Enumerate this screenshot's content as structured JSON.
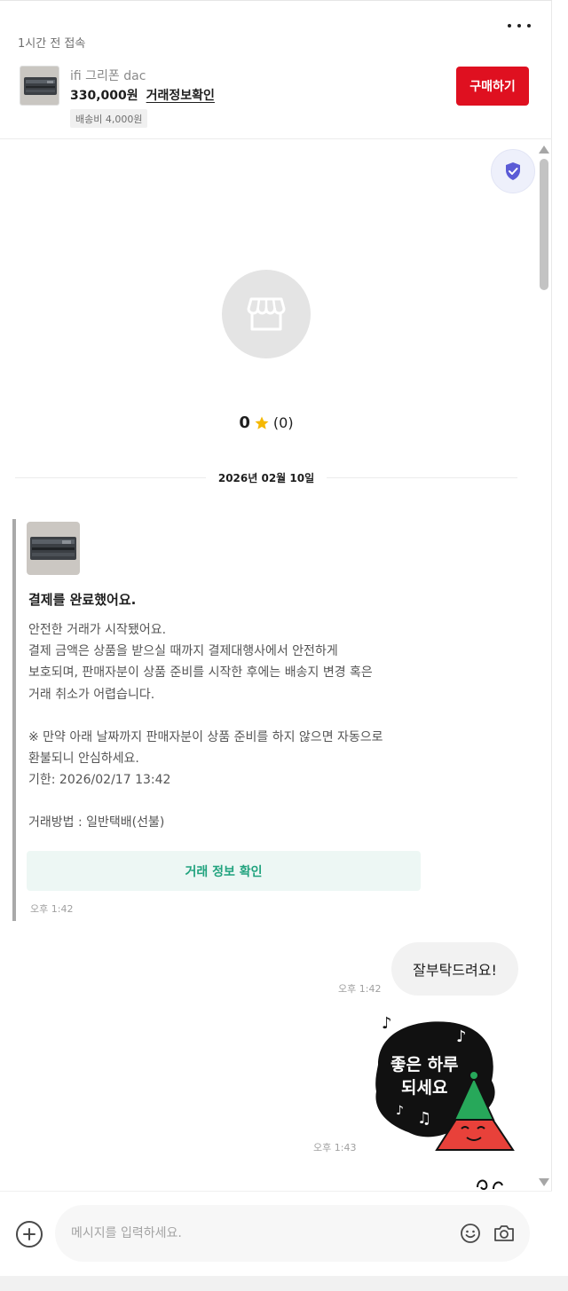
{
  "header": {
    "last_seen": "1시간 전 접속",
    "product_name": "ifi 그리폰 dac",
    "price": "330,000원",
    "deal_info_link": "거래정보확인",
    "shipping_fee": "배송비 4,000원",
    "buy_button": "구매하기",
    "more_icon": "more-horizontal-icon"
  },
  "profile": {
    "shield_icon": "shield-check-icon",
    "store_icon": "store-icon",
    "rating_score": "0",
    "rating_count": "(0)",
    "star_icon": "star-icon"
  },
  "date_divider": "2026년 02월 10일",
  "system_message": {
    "title": "결제를 완료했어요.",
    "body": [
      "안전한 거래가 시작됐어요.",
      "결제 금액은 상품을 받으실 때까지 결제대행사에서 안전하게",
      "보호되며, 판매자분이 상품 준비를 시작한 후에는 배송지 변경 혹은",
      "거래 취소가 어렵습니다.",
      "",
      "※ 만약 아래 날짜까지 판매자분이 상품 준비를 하지 않으면 자동으로",
      "환불되니 안심하세요.",
      "기한: 2026/02/17 13:42",
      "",
      "거래방법 : 일반택배(선불)"
    ],
    "button": "거래 정보 확인",
    "time": "오후 1:42"
  },
  "my_message": {
    "text": "잘부탁드려요!",
    "time": "오후 1:42"
  },
  "sticker": {
    "line1": "좋은 하루",
    "line2": "되세요",
    "time": "오후 1:43"
  },
  "input": {
    "placeholder": "메시지를 입력하세요.",
    "plus_icon": "plus-circle-icon",
    "emoji_icon": "smile-icon",
    "camera_icon": "camera-icon"
  },
  "colors": {
    "buy_button": "#df1020",
    "card_button_bg": "#edf7f4",
    "card_button_text": "#21a37e",
    "shield_bg": "#eef0fb",
    "shield_icon": "#5b5bd6",
    "star": "#f5b800",
    "sticker_bg": "#111111",
    "sticker_hat": "#27a85a",
    "sticker_face": "#e8413a"
  }
}
